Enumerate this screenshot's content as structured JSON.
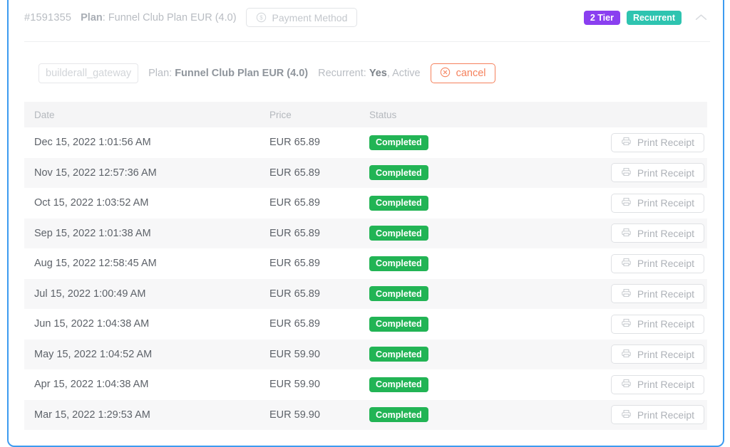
{
  "header": {
    "order_id": "#1591355",
    "plan_label": "Plan",
    "plan_sep": ": ",
    "plan_name": "Funnel Club Plan EUR (4.0)",
    "payment_method_button": "Payment Method",
    "payment_method_icon": "dollar-circle-icon",
    "badge_tier": "2 Tier",
    "badge_recurrent": "Recurrent",
    "collapse_icon": "chevron-up-icon",
    "colors": {
      "tier": "#8a3ff0",
      "recurrent": "#2ec4b0",
      "card_border": "#3d9bf0"
    }
  },
  "subscription": {
    "gateway": "builderall_gateway",
    "plan_label": "Plan: ",
    "plan_name": "Funnel Club Plan EUR (4.0)",
    "recurrent_label": "Recurrent: ",
    "recurrent_value": "Yes",
    "status_text": ", Active",
    "cancel_button": "cancel",
    "cancel_icon": "close-circle-icon",
    "cancel_color": "#f5815c"
  },
  "table": {
    "columns": [
      "Date",
      "Price",
      "Status",
      ""
    ],
    "print_button_label": "Print Receipt",
    "print_button_icon": "printer-icon",
    "status_color": "#22b455",
    "rows": [
      {
        "date": "Dec 15, 2022 1:01:56 AM",
        "price": "EUR 65.89",
        "status": "Completed",
        "action": "Print Receipt"
      },
      {
        "date": "Nov 15, 2022 12:57:36 AM",
        "price": "EUR 65.89",
        "status": "Completed",
        "action": "Print Receipt"
      },
      {
        "date": "Oct 15, 2022 1:03:52 AM",
        "price": "EUR 65.89",
        "status": "Completed",
        "action": "Print Receipt"
      },
      {
        "date": "Sep 15, 2022 1:01:38 AM",
        "price": "EUR 65.89",
        "status": "Completed",
        "action": "Print Receipt"
      },
      {
        "date": "Aug 15, 2022 12:58:45 AM",
        "price": "EUR 65.89",
        "status": "Completed",
        "action": "Print Receipt"
      },
      {
        "date": "Jul 15, 2022 1:00:49 AM",
        "price": "EUR 65.89",
        "status": "Completed",
        "action": "Print Receipt"
      },
      {
        "date": "Jun 15, 2022 1:04:38 AM",
        "price": "EUR 65.89",
        "status": "Completed",
        "action": "Print Receipt"
      },
      {
        "date": "May 15, 2022 1:04:52 AM",
        "price": "EUR 59.90",
        "status": "Completed",
        "action": "Print Receipt"
      },
      {
        "date": "Apr 15, 2022 1:04:38 AM",
        "price": "EUR 59.90",
        "status": "Completed",
        "action": "Print Receipt"
      },
      {
        "date": "Mar 15, 2022 1:29:53 AM",
        "price": "EUR 59.90",
        "status": "Completed",
        "action": "Print Receipt"
      }
    ]
  }
}
